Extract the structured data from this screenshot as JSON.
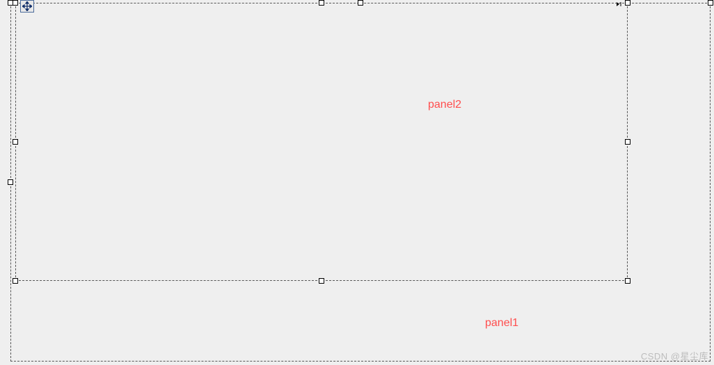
{
  "panels": {
    "inner": {
      "label": "panel2"
    },
    "outer": {
      "label": "panel1"
    }
  },
  "icons": {
    "move": "move-icon",
    "tag": "smart-tag-icon"
  },
  "watermark": "CSDN @星尘库"
}
